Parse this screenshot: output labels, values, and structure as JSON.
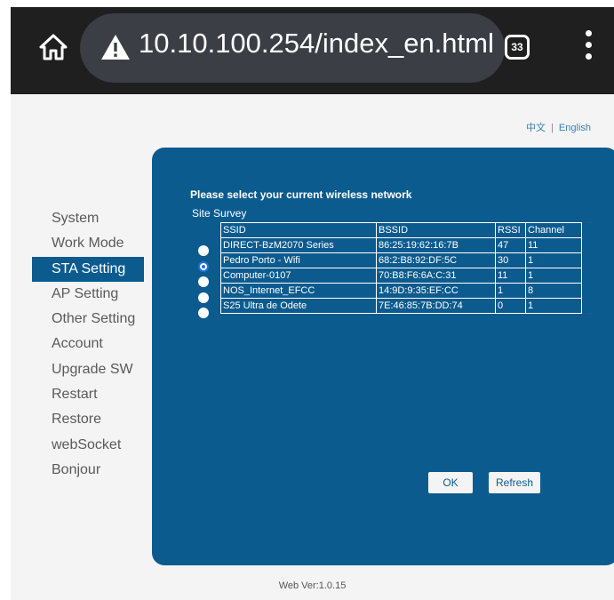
{
  "browser": {
    "url": "10.10.100.254/index_en.html",
    "tab_count": "33"
  },
  "language": {
    "chinese": "中文",
    "english": "English"
  },
  "sidebar": {
    "items": [
      {
        "label": "System",
        "active": false
      },
      {
        "label": "Work Mode",
        "active": false
      },
      {
        "label": "STA Setting",
        "active": true
      },
      {
        "label": "AP Setting",
        "active": false
      },
      {
        "label": "Other Setting",
        "active": false
      },
      {
        "label": "Account",
        "active": false
      },
      {
        "label": "Upgrade SW",
        "active": false
      },
      {
        "label": "Restart",
        "active": false
      },
      {
        "label": "Restore",
        "active": false
      },
      {
        "label": "webSocket",
        "active": false
      },
      {
        "label": "Bonjour",
        "active": false
      }
    ]
  },
  "panel": {
    "title": "Please select your current wireless network",
    "survey_label": "Site Survey",
    "columns": [
      "SSID",
      "BSSID",
      "RSSI",
      "Channel"
    ],
    "networks": [
      {
        "ssid": "DIRECT-BzM2070 Series",
        "bssid": "86:25:19:62:16:7B",
        "rssi": "47",
        "channel": "11",
        "selected": false
      },
      {
        "ssid": "Pedro Porto - Wifi",
        "bssid": "68:2:B8:92:DF:5C",
        "rssi": "30",
        "channel": "1",
        "selected": true
      },
      {
        "ssid": "Computer-0107",
        "bssid": "70:B8:F6:6A:C:31",
        "rssi": "11",
        "channel": "1",
        "selected": false
      },
      {
        "ssid": "NOS_Internet_EFCC",
        "bssid": "14:9D:9:35:EF:CC",
        "rssi": "1",
        "channel": "8",
        "selected": false
      },
      {
        "ssid": "S25 Ultra de Odete",
        "bssid": "7E:46:85:7B:DD:74",
        "rssi": "0",
        "channel": "1",
        "selected": false
      }
    ],
    "ok_label": "OK",
    "refresh_label": "Refresh"
  },
  "footer": {
    "version": "Web Ver:1.0.15"
  }
}
